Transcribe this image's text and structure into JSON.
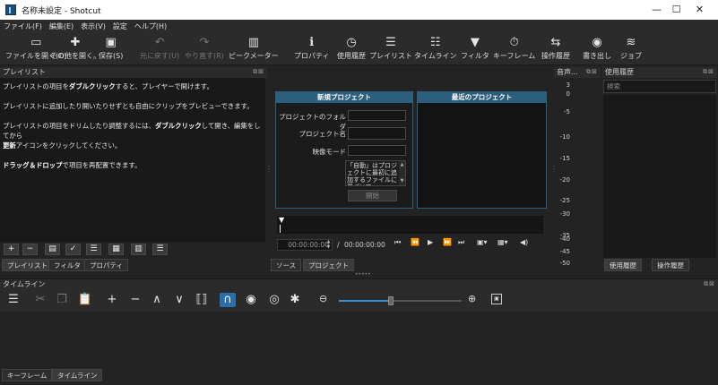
{
  "window": {
    "title": "名称未設定 - Shotcut",
    "min": "—",
    "max": "☐",
    "close": "✕"
  },
  "menu": [
    "ファイル(F)",
    "編集(E)",
    "表示(V)",
    "設定",
    "ヘルプ(H)"
  ],
  "toolbar": [
    {
      "label": "ファイルを開く(O)",
      "icon": "folder-open-icon",
      "glyph": "▭"
    },
    {
      "label": "その他を開く。",
      "icon": "open-other-icon",
      "glyph": "✚"
    },
    {
      "label": "保存(S)",
      "icon": "save-icon",
      "glyph": "▣"
    },
    {
      "label": "元に戻す(U)",
      "icon": "undo-icon",
      "glyph": "↶",
      "disabled": true
    },
    {
      "label": "やり直す(R)",
      "icon": "redo-icon",
      "glyph": "↷",
      "disabled": true
    },
    {
      "label": "ピークメーター",
      "icon": "peak-meter-icon",
      "glyph": "▥"
    },
    {
      "label": "プロパティ",
      "icon": "properties-icon",
      "glyph": "ℹ"
    },
    {
      "label": "使用履歴",
      "icon": "history-icon",
      "glyph": "◷"
    },
    {
      "label": "プレイリスト",
      "icon": "playlist-icon",
      "glyph": "☰"
    },
    {
      "label": "タイムライン",
      "icon": "timeline-icon",
      "glyph": "☷"
    },
    {
      "label": "フィルタ",
      "icon": "filter-icon",
      "glyph": "▼"
    },
    {
      "label": "キーフレーム",
      "icon": "keyframe-icon",
      "glyph": "⏱"
    },
    {
      "label": "操作履歴",
      "icon": "undo-history-icon",
      "glyph": "⇆"
    },
    {
      "label": "書き出し",
      "icon": "export-icon",
      "glyph": "◉"
    },
    {
      "label": "ジョブ",
      "icon": "jobs-icon",
      "glyph": "≋"
    }
  ],
  "playlist": {
    "title": "プレイリスト",
    "lines": [
      {
        "pre": "プレイリストの項目を",
        "b": "ダブルクリック",
        "post": "すると、プレイヤーで開けます。"
      },
      {
        "pre": "プレイリストに追加したり開いたりせずとも自由にクリップをプレビューできます。",
        "b": "",
        "post": ""
      },
      {
        "pre": "プレイリストの項目をドリムしたり調整するには、",
        "b": "ダブルクリック",
        "post": "して開き、編集をしてから"
      },
      {
        "pre": "",
        "b": "更新",
        "post": "アイコンをクリックしてください。"
      },
      {
        "pre": "",
        "b": "ドラッグ＆ドロップ",
        "post": "で項目を再配置できます。"
      }
    ],
    "buttons": [
      "+",
      "−",
      "▤",
      "✓",
      "☰",
      "▦",
      "▥",
      "☰"
    ],
    "tabs": [
      "プレイリスト",
      "フィルタ",
      "プロパティ"
    ]
  },
  "new_project": {
    "title": "新規プロジェクト",
    "folder_label": "プロジェクトのフォルダ",
    "name_label": "プロジェクト名",
    "mode_label": "映像モード",
    "note": "「自動」はプロジェクトに最初に追加するファイルに基づいて",
    "note_b1": "自動",
    "note_b2": "最初",
    "note_b3": "追加",
    "start_button": "開始"
  },
  "recent": {
    "title": "最近のプロジェクト"
  },
  "player": {
    "position": "00:00:00:00",
    "separator": "/",
    "duration": "00:00:00:00",
    "tabs": [
      "ソース",
      "プロジェクト"
    ]
  },
  "meter": {
    "title": "音声...",
    "labels": [
      "3",
      "0",
      "-5",
      "-10",
      "-15",
      "-20",
      "-25",
      "-30",
      "-35",
      "-40",
      "-45",
      "-50"
    ]
  },
  "history": {
    "title": "使用履歴",
    "search_placeholder": "検索",
    "tabs": [
      "使用履歴",
      "操作履歴"
    ]
  },
  "timeline": {
    "title": "タイムライン",
    "tabs": [
      "キーフレーム",
      "タイムライン"
    ],
    "zoom_level": 0.42,
    "tools": [
      {
        "name": "timeline-menu-icon",
        "glyph": "☰"
      },
      {
        "name": "cut-icon",
        "glyph": "✂",
        "dis": true
      },
      {
        "name": "copy-icon",
        "glyph": "❐",
        "dis": true
      },
      {
        "name": "paste-icon",
        "glyph": "📋"
      },
      {
        "name": "append-icon",
        "glyph": "+"
      },
      {
        "name": "remove-icon",
        "glyph": "−"
      },
      {
        "name": "lift-icon",
        "glyph": "∧"
      },
      {
        "name": "overwrite-icon",
        "glyph": "∨"
      },
      {
        "name": "split-icon",
        "glyph": "⟦⟧"
      },
      {
        "name": "snap-icon",
        "glyph": "∩",
        "active": true
      },
      {
        "name": "scrub-icon",
        "glyph": "◉"
      },
      {
        "name": "ripple-icon",
        "glyph": "◎"
      },
      {
        "name": "ripple-all-icon",
        "glyph": "✱"
      }
    ]
  },
  "colors": {
    "accent": "#2c5e7d",
    "bg": "#232323"
  }
}
